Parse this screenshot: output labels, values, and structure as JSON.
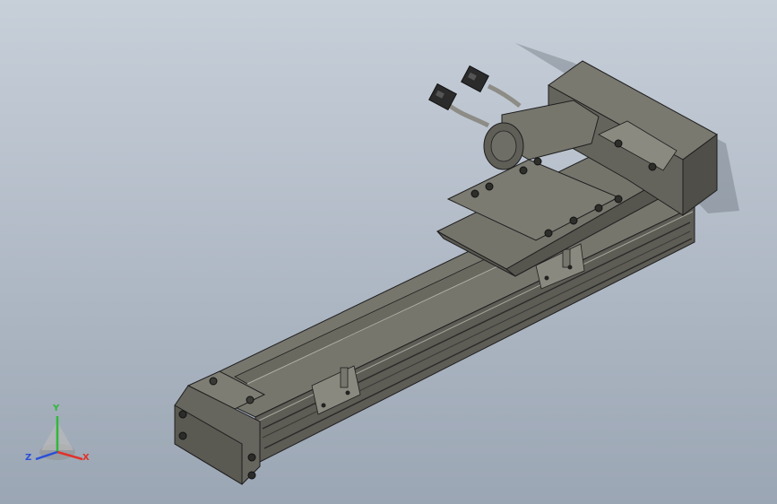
{
  "view": {
    "background_top": "#c7cfd9",
    "background_bottom": "#9ba6b4",
    "model_name": ""
  },
  "triad": {
    "x_label": "X",
    "y_label": "Y",
    "z_label": "Z",
    "x_color": "#e0322b",
    "y_color": "#2fb83a",
    "z_color": "#2a4fd8"
  },
  "model": {
    "body_color": "#6b6a62",
    "body_dark": "#4a4944",
    "body_light": "#8a897f",
    "edge_color": "#1e1e1e",
    "cable_color": "#8d8c86",
    "connector_color": "#2b2b2b"
  }
}
